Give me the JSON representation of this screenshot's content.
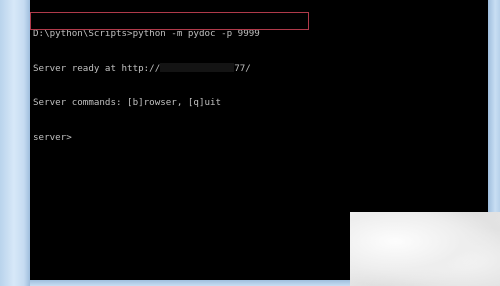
{
  "console": {
    "lines": [
      "D:\\python\\Scripts>python -m pydoc -p 9999",
      "Server ready at http://",
      "77/",
      "Server commands: [b]rowser, [q]uit",
      "server>"
    ]
  },
  "colors": {
    "background": "#000000",
    "text": "#c0c0c0",
    "highlight_border": "#b03a4a"
  }
}
